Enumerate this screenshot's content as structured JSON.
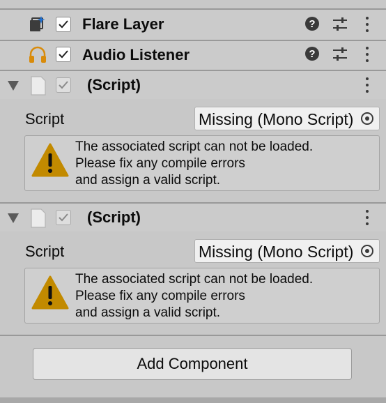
{
  "components": [
    {
      "title": "Flare Layer",
      "icon": "flare-layer-icon",
      "enabled": true
    },
    {
      "title": "Audio Listener",
      "icon": "headphones-icon",
      "enabled": true
    }
  ],
  "scripts": [
    {
      "title": "(Script)",
      "field_label": "Script",
      "field_value": "Missing (Mono Script)",
      "help_lines": [
        "The associated script can not be loaded.",
        "Please fix any compile errors",
        "and assign a valid script."
      ]
    },
    {
      "title": "(Script)",
      "field_label": "Script",
      "field_value": "Missing (Mono Script)",
      "help_lines": [
        "The associated script can not be loaded.",
        "Please fix any compile errors",
        "and assign a valid script."
      ]
    }
  ],
  "add_component": {
    "label": "Add Component"
  },
  "colors": {
    "warning": "#c28a00",
    "accent_blue": "#1f6fd0",
    "headphones": "#d98b0a"
  }
}
